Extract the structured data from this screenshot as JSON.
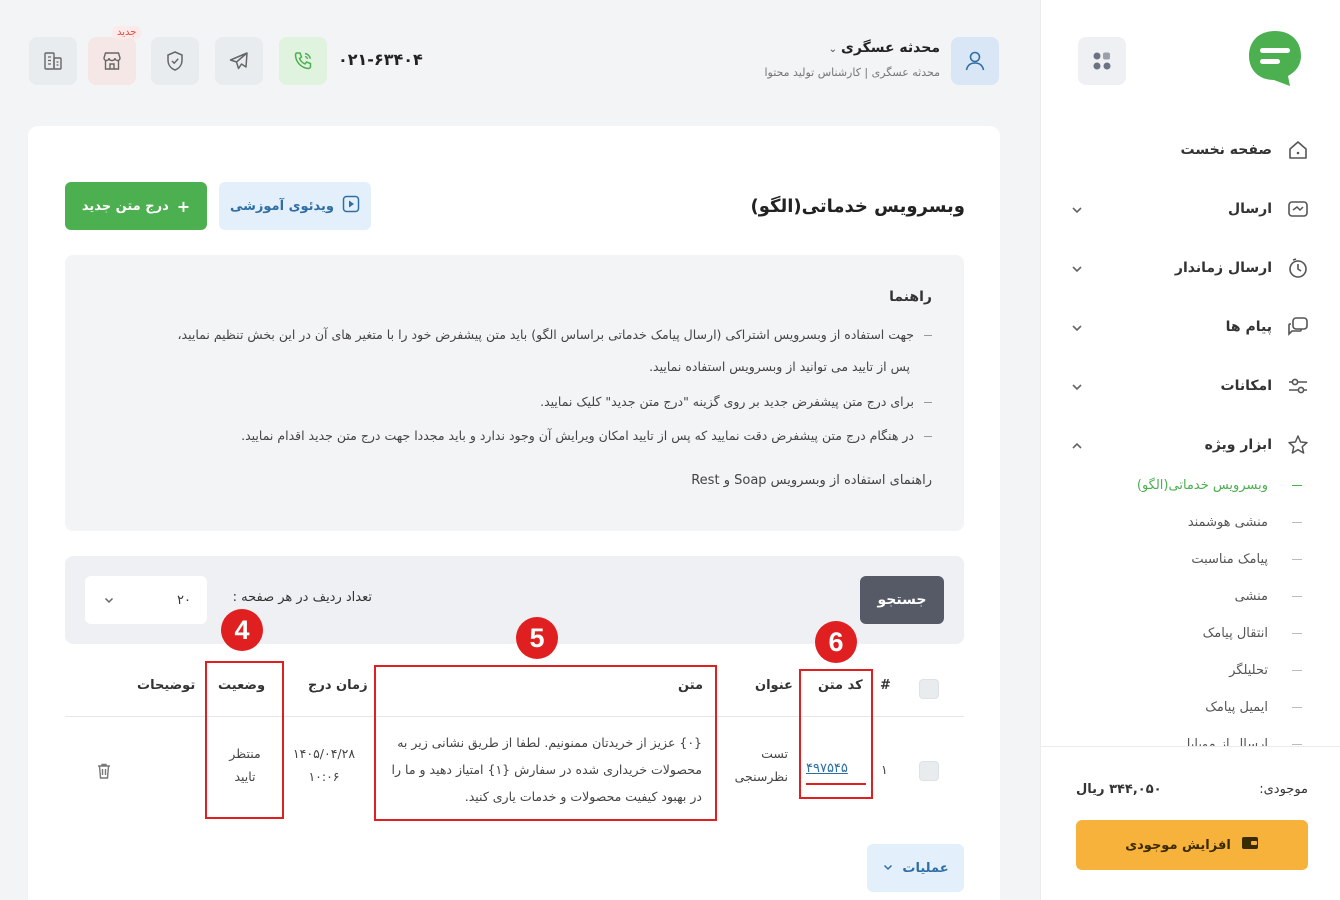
{
  "sidebar": {
    "nav": [
      {
        "label": "صفحه نخست",
        "icon": "home-icon",
        "has_chevron": false
      },
      {
        "label": "ارسال",
        "icon": "send-message-icon",
        "has_chevron": true
      },
      {
        "label": "ارسال زماندار",
        "icon": "scheduled-send-icon",
        "has_chevron": true
      },
      {
        "label": "پیام ها",
        "icon": "messages-icon",
        "has_chevron": true
      },
      {
        "label": "امکانات",
        "icon": "settings-sliders-icon",
        "has_chevron": true
      },
      {
        "label": "ابزار ویژه",
        "icon": "star-icon",
        "has_chevron": true,
        "expanded": true
      }
    ],
    "subnav": [
      {
        "label": "وبسرویس خدماتی(الگو)",
        "active": true
      },
      {
        "label": "منشی هوشمند",
        "active": false
      },
      {
        "label": "پیامک مناسبت",
        "active": false
      },
      {
        "label": "منشی",
        "active": false
      },
      {
        "label": "انتقال پیامک",
        "active": false
      },
      {
        "label": "تحلیلگر",
        "active": false
      },
      {
        "label": "ایمیل پیامک",
        "active": false
      },
      {
        "label": "ارسال از موبایل",
        "active": false
      }
    ],
    "balance_label": "موجودی:",
    "balance_value": "۳۴۴,۰۵۰ ریال",
    "topup_label": "افزایش موجودی"
  },
  "header": {
    "user_name": "محدثه عسگری",
    "user_role": "محدثه عسگری | کارشناس تولید محتوا",
    "phone": "۰۲۱-۶۳۴۰۴",
    "new_badge": "جدید"
  },
  "page": {
    "title": "وبسرویس خدماتی(الگو)",
    "video_button": "ویدئوی آموزشی",
    "new_button": "درج متن جدید"
  },
  "guide": {
    "title": "راهنما",
    "lines": [
      "جهت استفاده از وبسرویس اشتراکی (ارسال پیامک خدماتی براساس الگو) باید متن پیشفرض خود را با متغیر های آن در این بخش تنظیم نمایید،",
      "پس از تایید می توانید از وبسرویس استفاده نمایید.",
      "برای درج متن پیشفرض جدید بر روی گزینه \"درج متن جدید\" کلیک نمایید.",
      "در هنگام درج متن پیشفرض دقت نمایید که پس از تایید امکان ویرایش آن وجود ندارد و باید مجددا جهت درج متن جدید اقدام نمایید."
    ],
    "link": "راهنمای استفاده از وبسرویس Soap و Rest"
  },
  "filter": {
    "search_button": "جستجو",
    "rows_label": "تعداد ردیف در هر صفحه :",
    "rows_value": "۲۰"
  },
  "table": {
    "headers": {
      "index": "#",
      "code": "کد متن",
      "title": "عنوان",
      "text": "متن",
      "date": "زمان درج",
      "status": "وضعیت",
      "notes": "توضیحات"
    },
    "rows": [
      {
        "index": "۱",
        "code": "۴۹۷۵۴۵",
        "title_line1": "تست",
        "title_line2": "نظرسنجی",
        "text_line1": "{۰} عزیز از خریدتان ممنونیم. لطفا از طریق نشانی زیر به",
        "text_line2": "محصولات خریداری شده در سفارش {۱} امتیاز دهید و ما را",
        "text_line3": "در بهبود کیفیت محصولات و خدمات یاری کنید.",
        "date_line1": "۱۴۰۵/۰۴/۲۸",
        "date_line2": "۱۰:۰۶",
        "status_line1": "منتظر",
        "status_line2": "تایید"
      }
    ]
  },
  "annotations": {
    "marker_status": "4",
    "marker_text": "5",
    "marker_code": "6"
  },
  "ops_button": "عملیات",
  "colors": {
    "primary_green": "#4caf50",
    "accent_orange": "#f7b23b",
    "link_blue": "#2f6ea5",
    "annotation_red": "#e02020"
  }
}
